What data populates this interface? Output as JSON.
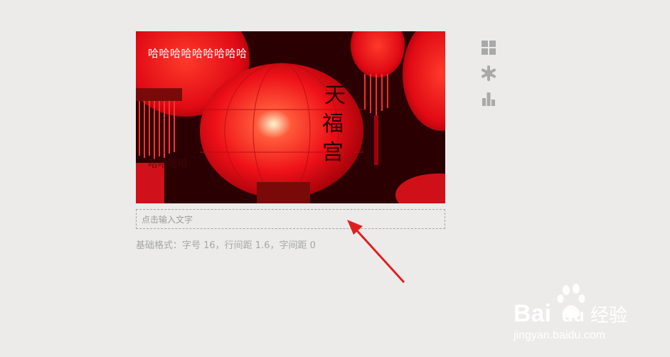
{
  "card": {
    "title": "哈哈哈哈哈哈哈哈哈",
    "subtitle": "哈哈哈哈",
    "lantern_text": [
      "天",
      "福",
      "宫"
    ]
  },
  "input": {
    "placeholder": "点击输入文字"
  },
  "hint": {
    "text": "基础格式：字号 16，行间距 1.6，字间距 0"
  },
  "toolbar": {
    "icons": [
      "layout-grid-icon",
      "gear-icon",
      "bar-chart-icon"
    ]
  },
  "watermark": {
    "logo_text": "Bai",
    "logo_text2": "du",
    "logo_cn": "经验",
    "url": "jingyan.baidu.com"
  },
  "colors": {
    "background": "#ecebea",
    "lantern": "#e8101a",
    "arrow": "#e02020",
    "icon": "#a9a9a9"
  }
}
